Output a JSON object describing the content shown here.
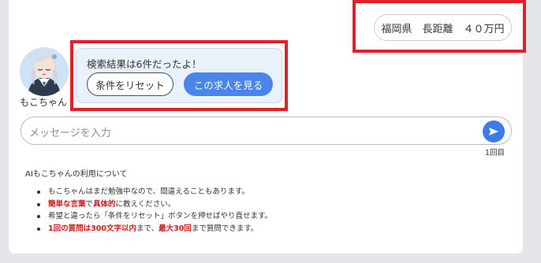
{
  "chat": {
    "user_message": "福岡県　長距離　４０万円",
    "bot_name": "もこちゃん",
    "bot_message": "検索結果は6件だったよ！",
    "reset_button": "条件をリセット",
    "view_button": "この求人を見る"
  },
  "input": {
    "placeholder": "メッセージを入力",
    "counter": "1回目"
  },
  "about": {
    "title": "AIもこちゃんの利用について",
    "notes": [
      {
        "plain": "もこちゃんはまだ勉強中なので、間違えることもあります。"
      },
      {
        "bold1": "簡単な言葉",
        "text1": "で",
        "bold2": "具体的",
        "text2": "に教えください。"
      },
      {
        "plain": "希望と違ったら「条件をリセット」ボタンを押せばやり直せます。"
      },
      {
        "bold1": "1回の質問は300文字以内",
        "text1": "まで、",
        "bold2": "最大30回",
        "text2": "まで質問できます。"
      }
    ]
  },
  "colors": {
    "highlight": "#e0202a",
    "primary_button": "#4a85ec",
    "send_button": "#3d7ce6",
    "bot_bubble": "#e9f1fb",
    "emphasis": "#cc1f1f"
  }
}
